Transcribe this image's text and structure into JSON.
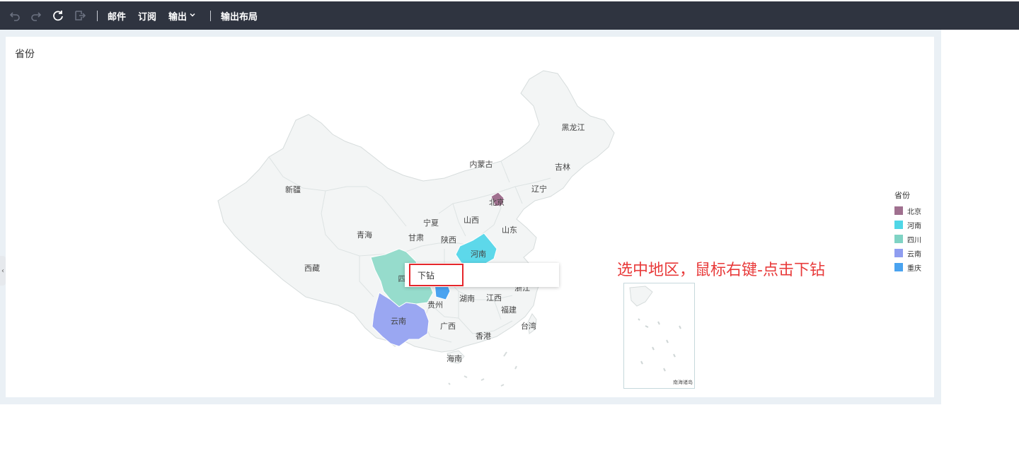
{
  "toolbar": {
    "undo_icon": "undo-icon",
    "redo_icon": "redo-icon",
    "refresh_icon": "refresh-icon",
    "export_icon": "export-icon",
    "mail_label": "邮件",
    "subscribe_label": "订阅",
    "output_label": "输出",
    "output_layout_label": "输出布局"
  },
  "card": {
    "title": "省份"
  },
  "map": {
    "provinces": {
      "xinjiang": "新疆",
      "xizang": "西藏",
      "qinghai": "青海",
      "gansu": "甘肃",
      "ningxia": "宁夏",
      "neimenggu": "内蒙古",
      "heilongjiang": "黑龙江",
      "jilin": "吉林",
      "liaoning": "辽宁",
      "beijing": "北京",
      "shanxi": "山西",
      "shandong": "山东",
      "shaanxi": "陕西",
      "henan": "河南",
      "sichuan": "四",
      "yunnan": "云南",
      "guizhou": "贵州",
      "guangxi": "广西",
      "hunan": "湖南",
      "jiangxi": "江西",
      "fujian": "福建",
      "zhejiang": "浙江",
      "taiwan": "台湾",
      "xianggang": "香港",
      "hainan": "海南",
      "chongqing": "重庆"
    },
    "inset_label": "南海诸岛",
    "selected_colors": {
      "beijing": "#a0708f",
      "henan": "#5dd8ea",
      "sichuan": "#96dccc",
      "yunnan": "#9aa7f2",
      "chongqing": "#4aa3f0"
    }
  },
  "context_menu": {
    "drill_down_label": "下钻"
  },
  "annotation": {
    "text": "选中地区，鼠标右键-点击下钻"
  },
  "legend": {
    "title": "省份",
    "items": [
      {
        "label": "北京",
        "color": "#a0708f"
      },
      {
        "label": "河南",
        "color": "#4fd6e6"
      },
      {
        "label": "四川",
        "color": "#7fd3c4"
      },
      {
        "label": "云南",
        "color": "#8f9df0"
      },
      {
        "label": "重庆",
        "color": "#4aa3f0"
      }
    ]
  },
  "sidebar": {
    "collapse_glyph": "‹"
  }
}
